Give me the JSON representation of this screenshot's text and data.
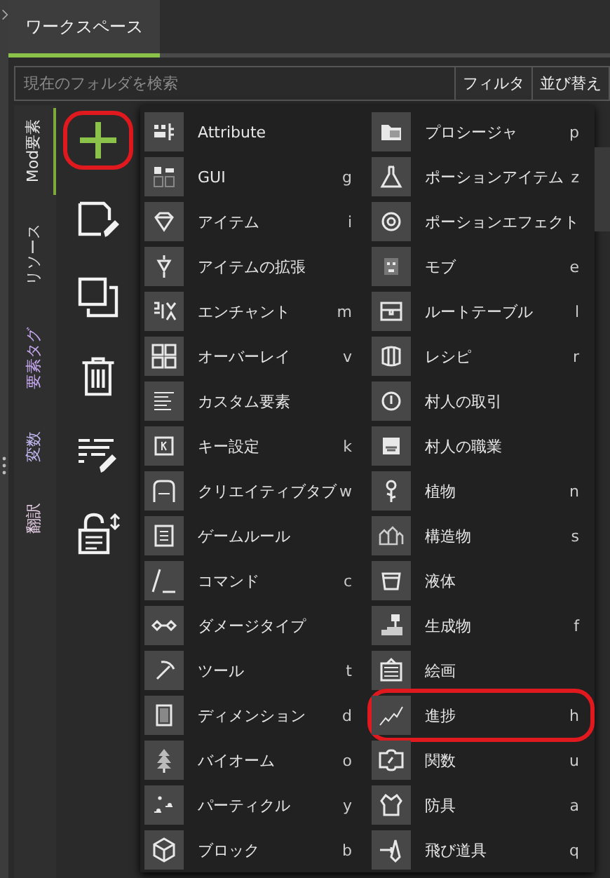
{
  "tabs": [
    {
      "label": "ワークスペース",
      "selected": true
    }
  ],
  "search": {
    "placeholder": "現在のフォルダを検索"
  },
  "search_buttons": [
    "フィルタ",
    "並び替え"
  ],
  "side_tabs": [
    {
      "label": "Mod要素",
      "selected": true,
      "color": "#e6e6e6"
    },
    {
      "label": "リソース",
      "selected": false,
      "color": "#d8d8d8"
    },
    {
      "label": "要素タグ",
      "selected": false,
      "color": "#c6a8f0"
    },
    {
      "label": "変数",
      "selected": false,
      "color": "#c0b8f0"
    },
    {
      "label": "翻訳",
      "selected": false,
      "color": "#e8d0e8"
    }
  ],
  "tools": [
    {
      "kind": "add",
      "highlighted": true
    },
    {
      "kind": "edit",
      "highlighted": false
    },
    {
      "kind": "duplicate",
      "highlighted": false
    },
    {
      "kind": "delete",
      "highlighted": false
    },
    {
      "kind": "list-edit",
      "highlighted": false
    },
    {
      "kind": "lock",
      "highlighted": false
    }
  ],
  "menu_columns": [
    [
      {
        "label": "Attribute",
        "highlighted": false
      },
      {
        "label": "GUI",
        "shortcut": "g",
        "highlighted": false
      },
      {
        "label": "アイテム",
        "shortcut": "i",
        "highlighted": false
      },
      {
        "label": "アイテムの拡張",
        "highlighted": false
      },
      {
        "label": "エンチャント",
        "shortcut": "m",
        "highlighted": false
      },
      {
        "label": "オーバーレイ",
        "shortcut": "v",
        "highlighted": false
      },
      {
        "label": "カスタム要素",
        "highlighted": false
      },
      {
        "label": "キー設定",
        "shortcut": "k",
        "highlighted": false
      },
      {
        "label": "クリエイティブタブ",
        "shortcut": "w",
        "highlighted": false
      },
      {
        "label": "ゲームルール",
        "highlighted": false
      },
      {
        "label": "コマンド",
        "shortcut": "c",
        "highlighted": false
      },
      {
        "label": "ダメージタイプ",
        "highlighted": false
      },
      {
        "label": "ツール",
        "shortcut": "t",
        "highlighted": false
      },
      {
        "label": "ディメンション",
        "shortcut": "d",
        "highlighted": false
      },
      {
        "label": "バイオーム",
        "shortcut": "o",
        "highlighted": false
      },
      {
        "label": "パーティクル",
        "shortcut": "y",
        "highlighted": false
      },
      {
        "label": "ブロック",
        "shortcut": "b",
        "highlighted": false
      }
    ],
    [
      {
        "label": "プロシージャ",
        "shortcut": "p",
        "highlighted": false
      },
      {
        "label": "ポーションアイテム",
        "shortcut": "z",
        "highlighted": false
      },
      {
        "label": "ポーションエフェクト",
        "highlighted": false
      },
      {
        "label": "モブ",
        "shortcut": "e",
        "highlighted": false
      },
      {
        "label": "ルートテーブル",
        "shortcut": "l",
        "highlighted": false
      },
      {
        "label": "レシピ",
        "shortcut": "r",
        "highlighted": false
      },
      {
        "label": "村人の取引",
        "highlighted": false
      },
      {
        "label": "村人の職業",
        "highlighted": false
      },
      {
        "label": "植物",
        "shortcut": "n",
        "highlighted": false
      },
      {
        "label": "構造物",
        "shortcut": "s",
        "highlighted": false
      },
      {
        "label": "液体",
        "highlighted": false
      },
      {
        "label": "生成物",
        "shortcut": "f",
        "highlighted": false
      },
      {
        "label": "絵画",
        "highlighted": false
      },
      {
        "label": "進捗",
        "shortcut": "h",
        "highlighted": true
      },
      {
        "label": "関数",
        "shortcut": "u",
        "highlighted": false
      },
      {
        "label": "防具",
        "shortcut": "a",
        "highlighted": false
      },
      {
        "label": "飛び道具",
        "shortcut": "q",
        "highlighted": false
      }
    ]
  ]
}
